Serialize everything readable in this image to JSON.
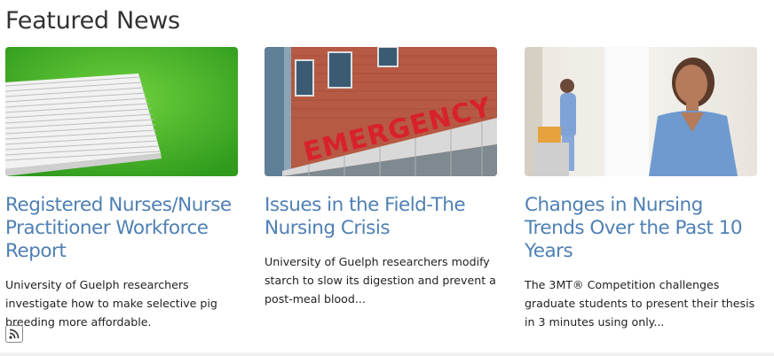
{
  "section": {
    "title": "Featured News"
  },
  "cards": [
    {
      "image_alt": "paper-stack-image",
      "headline": "Registered Nurses/Nurse Practitioner Workforce Report",
      "summary": "University of Guelph researchers investigate how to make selective pig breeding more affordable."
    },
    {
      "image_alt": "emergency-sign-image",
      "image_text": "EMERGENCY",
      "headline": "Issues in the Field-The Nursing Crisis",
      "summary": "University of Guelph researchers modify starch to slow its digestion and prevent a post-meal blood..."
    },
    {
      "image_alt": "nurse-photo-image",
      "headline": "Changes in Nursing Trends Over the Past 10 Years",
      "summary": "The 3MT® Competition challenges graduate students to present their thesis in 3 minutes using only..."
    }
  ],
  "icons": {
    "feed": "rss-icon"
  },
  "colors": {
    "headline": "#4f80b4",
    "title": "#333333",
    "body": "#222222",
    "green": "#45b52c",
    "brick": "#c0604a",
    "sign_red": "#d8212b"
  }
}
